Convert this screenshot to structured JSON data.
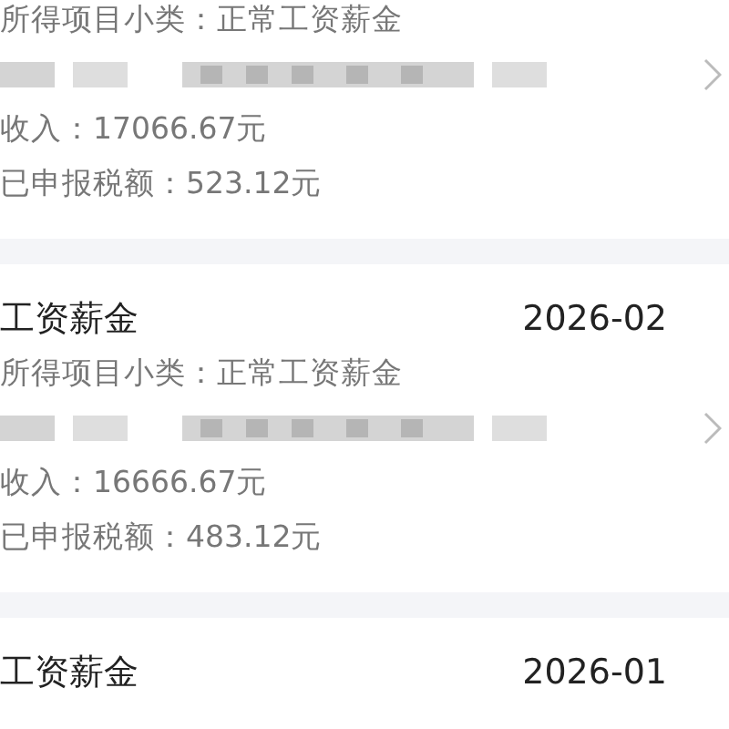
{
  "records": [
    {
      "subcategory": "所得项目小类：正常工资薪金",
      "redacted": true,
      "income": "收入：17066.67元",
      "tax": "已申报税额：523.12元"
    },
    {
      "title": "工资薪金",
      "period": "2026-02",
      "subcategory": "所得项目小类：正常工资薪金",
      "redacted": true,
      "income": "收入：16666.67元",
      "tax": "已申报税额：483.12元"
    },
    {
      "title": "工资薪金",
      "period": "2026-01"
    }
  ]
}
